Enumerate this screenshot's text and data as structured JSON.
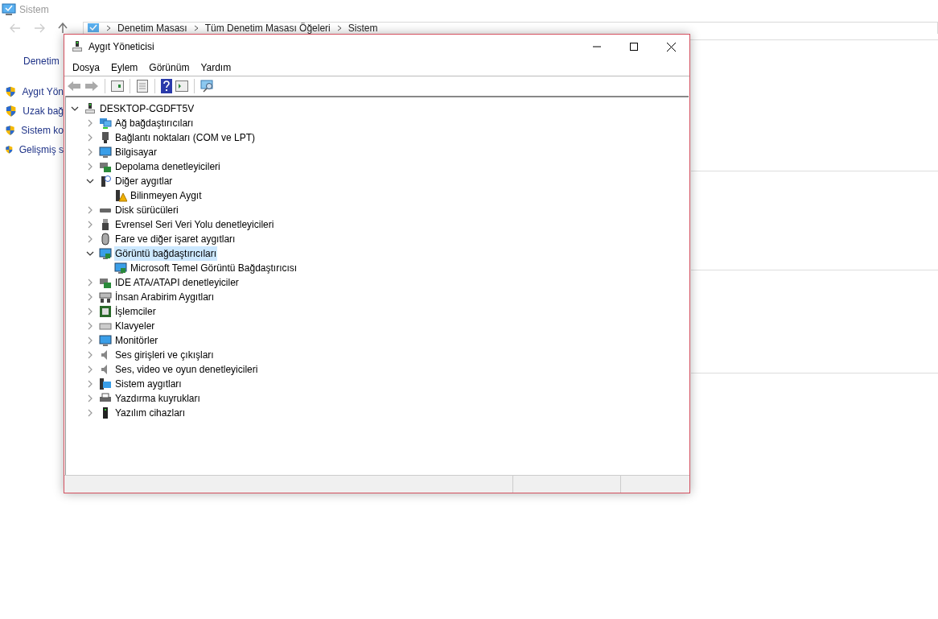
{
  "background_window": {
    "title": "Sistem",
    "breadcrumb": [
      "Denetim Masası",
      "Tüm Denetim Masası Öğeleri",
      "Sistem"
    ],
    "left_heading": "Denetim",
    "sidebar_links": [
      "Aygıt Yön",
      "Uzak bağ",
      "Sistem ko",
      "Gelişmiş s"
    ]
  },
  "window": {
    "title": "Aygıt Yöneticisi"
  },
  "menu": [
    "Dosya",
    "Eylem",
    "Görünüm",
    "Yardım"
  ],
  "tree": {
    "label": "DESKTOP-CGDFT5V",
    "expanded": true,
    "selected": false,
    "children": [
      {
        "label": "Ağ bağdaştırıcıları",
        "expanded": false,
        "selected": false
      },
      {
        "label": "Bağlantı noktaları (COM ve LPT)",
        "expanded": false,
        "selected": false
      },
      {
        "label": "Bilgisayar",
        "expanded": false,
        "selected": false
      },
      {
        "label": "Depolama denetleyicileri",
        "expanded": false,
        "selected": false
      },
      {
        "label": "Diğer aygıtlar",
        "expanded": true,
        "selected": false,
        "children": [
          {
            "label": "Bilinmeyen Aygıt",
            "selected": false
          }
        ]
      },
      {
        "label": "Disk sürücüleri",
        "expanded": false,
        "selected": false
      },
      {
        "label": "Evrensel Seri Veri Yolu denetleyicileri",
        "expanded": false,
        "selected": false
      },
      {
        "label": "Fare ve diğer işaret aygıtları",
        "expanded": false,
        "selected": false
      },
      {
        "label": "Görüntü bağdaştırıcıları",
        "expanded": true,
        "selected": true,
        "children": [
          {
            "label": "Microsoft Temel Görüntü Bağdaştırıcısı",
            "selected": false
          }
        ]
      },
      {
        "label": "IDE ATA/ATAPI denetleyiciler",
        "expanded": false,
        "selected": false
      },
      {
        "label": "İnsan Arabirim Aygıtları",
        "expanded": false,
        "selected": false
      },
      {
        "label": "İşlemciler",
        "expanded": false,
        "selected": false
      },
      {
        "label": "Klavyeler",
        "expanded": false,
        "selected": false
      },
      {
        "label": "Monitörler",
        "expanded": false,
        "selected": false
      },
      {
        "label": "Ses girişleri ve çıkışları",
        "expanded": false,
        "selected": false
      },
      {
        "label": "Ses, video ve oyun denetleyicileri",
        "expanded": false,
        "selected": false
      },
      {
        "label": "Sistem aygıtları",
        "expanded": false,
        "selected": false
      },
      {
        "label": "Yazdırma kuyrukları",
        "expanded": false,
        "selected": false
      },
      {
        "label": "Yazılım cihazları",
        "expanded": false,
        "selected": false
      }
    ]
  }
}
